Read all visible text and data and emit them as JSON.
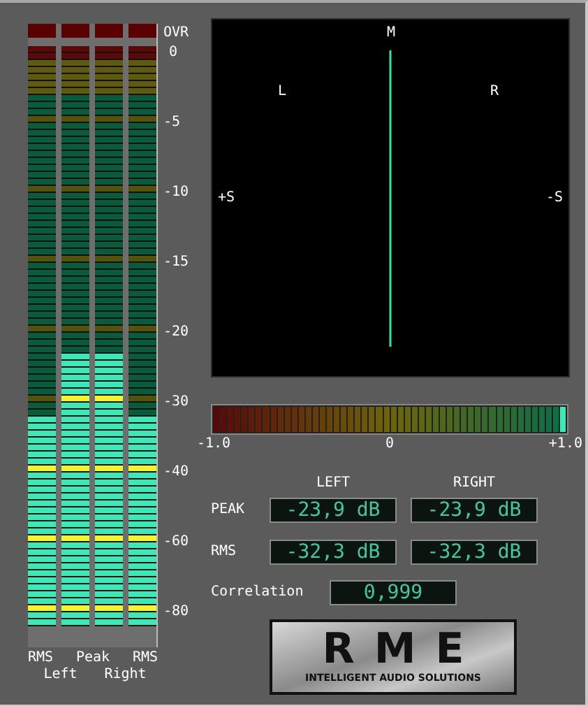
{
  "meter": {
    "scale": [
      "OVR",
      "0",
      "-5",
      "-10",
      "-15",
      "-20",
      "-30",
      "-40",
      "-60",
      "-80"
    ],
    "channels": [
      {
        "level": 0.361,
        "clip": false
      },
      {
        "level": 0.47,
        "clip": false
      },
      {
        "level": 0.47,
        "clip": false
      },
      {
        "level": 0.361,
        "clip": false
      }
    ],
    "captions_top": [
      "RMS",
      "Peak",
      "RMS"
    ],
    "captions_bottom": [
      "Left",
      "Right"
    ]
  },
  "goniometer": {
    "labels": [
      {
        "text": "M",
        "kind": "top"
      },
      {
        "text": "L",
        "kind": "left"
      },
      {
        "text": "R",
        "kind": "right"
      },
      {
        "text": "+S",
        "kind": "side"
      },
      {
        "text": "-S",
        "kind": "edge"
      }
    ]
  },
  "correlation_bar": {
    "level": 1,
    "scale": [
      "-1.0",
      "0",
      "+1.0"
    ]
  },
  "readouts": {
    "headers": [
      "LEFT",
      "RIGHT"
    ],
    "rows": [
      {
        "label": "PEAK",
        "values": [
          "-23,9 dB",
          "-23,9 dB"
        ]
      },
      {
        "label": "RMS",
        "values": [
          "-32,3 dB",
          "-32,3 dB"
        ]
      }
    ],
    "correlation": {
      "label": "Correlation",
      "value": "0,999"
    }
  },
  "logo": {
    "name": "RME",
    "tagline": "INTELLIGENT AUDIO SOLUTIONS"
  }
}
